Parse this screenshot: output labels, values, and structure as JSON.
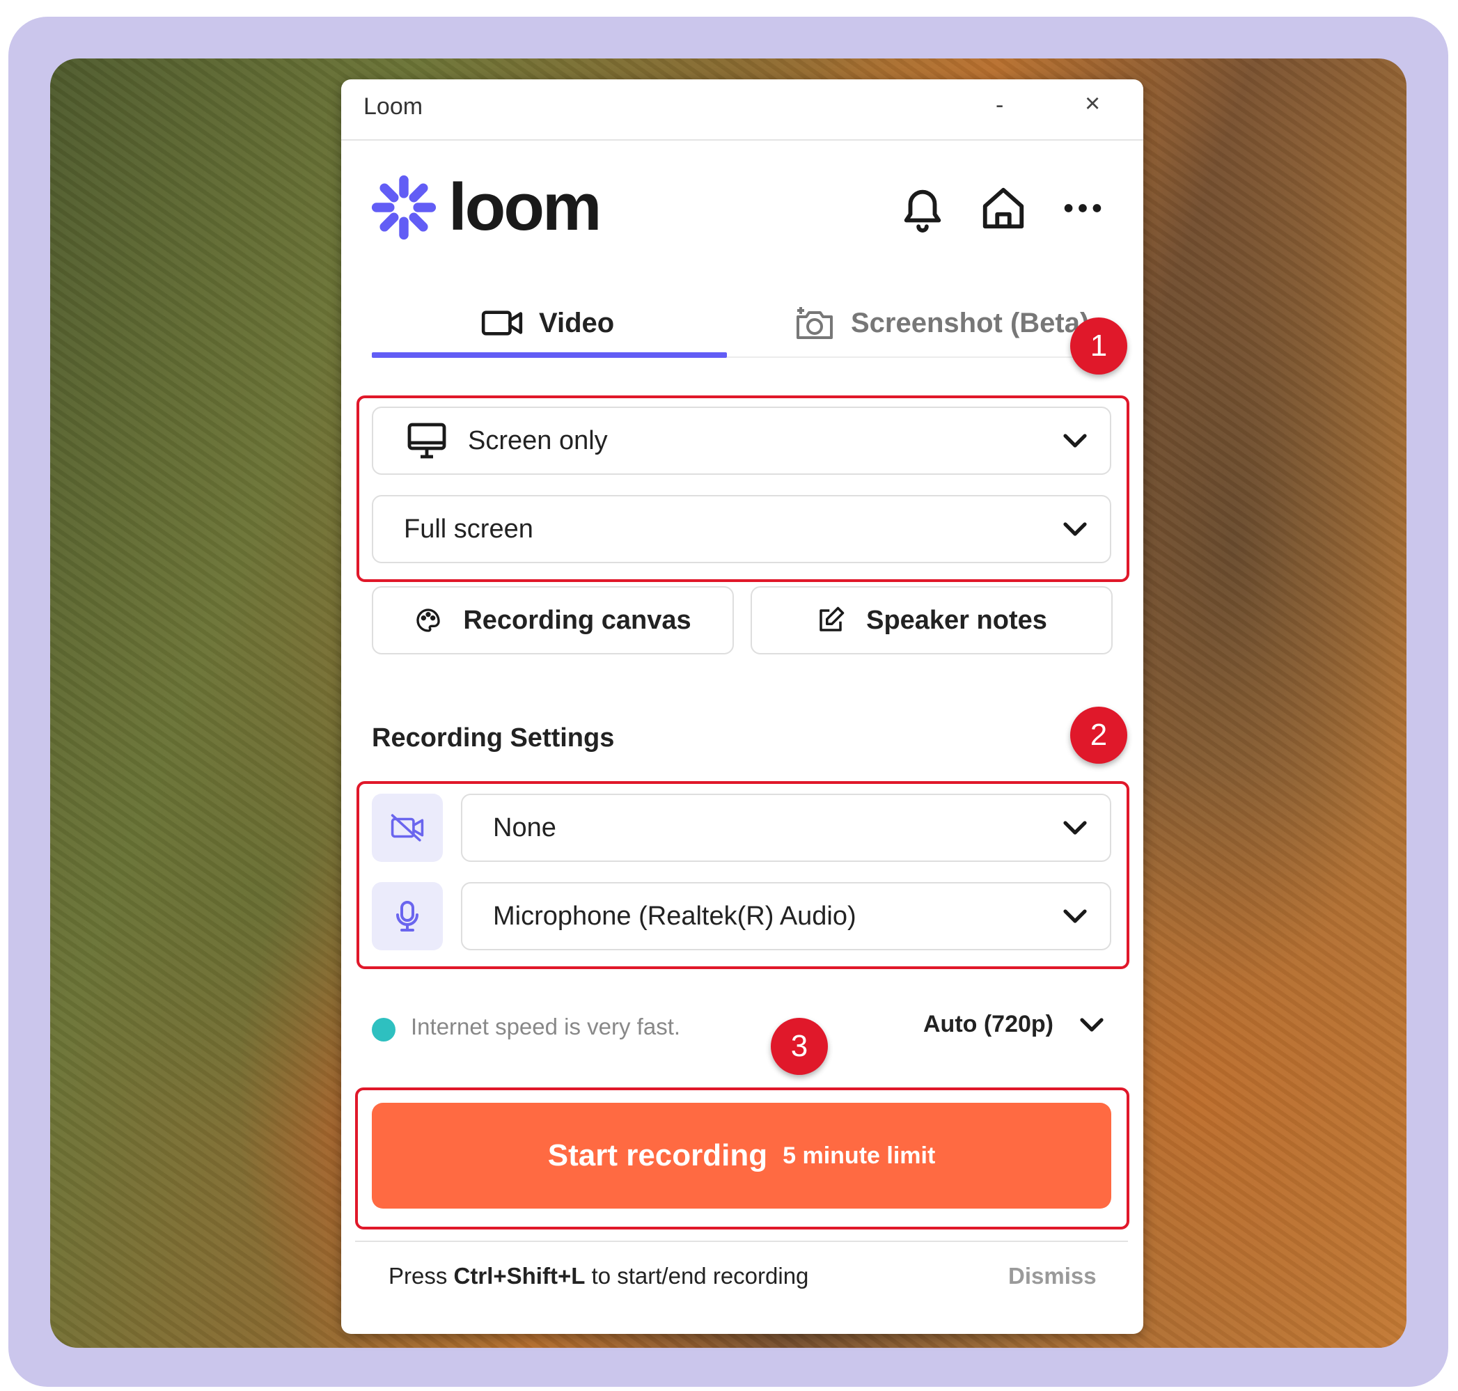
{
  "window": {
    "title": "Loom",
    "minimize": "-",
    "close": "×"
  },
  "brand": {
    "name": "loom",
    "accent": "#625df5"
  },
  "header_icons": [
    "bell-icon",
    "home-icon",
    "more-icon"
  ],
  "tabs": [
    {
      "label": "Video",
      "icon": "video-camera-icon",
      "active": true
    },
    {
      "label": "Screenshot (Beta)",
      "icon": "camera-icon",
      "active": false
    }
  ],
  "capture": {
    "mode": "Screen only",
    "area": "Full screen"
  },
  "tools": {
    "canvas_label": "Recording canvas",
    "notes_label": "Speaker notes"
  },
  "settings": {
    "title": "Recording Settings",
    "camera": "None",
    "microphone": "Microphone (Realtek(R) Audio)"
  },
  "status": {
    "speed_text": "Internet speed is very fast.",
    "speed_color": "#2ec0c0",
    "quality": "Auto (720p)"
  },
  "start": {
    "label": "Start recording",
    "limit": "5 minute limit",
    "color": "#ff6a42"
  },
  "hint": {
    "prefix": "Press ",
    "shortcut": "Ctrl+Shift+L",
    "suffix": " to start/end recording",
    "dismiss": "Dismiss"
  },
  "annotations": [
    "1",
    "2",
    "3"
  ]
}
